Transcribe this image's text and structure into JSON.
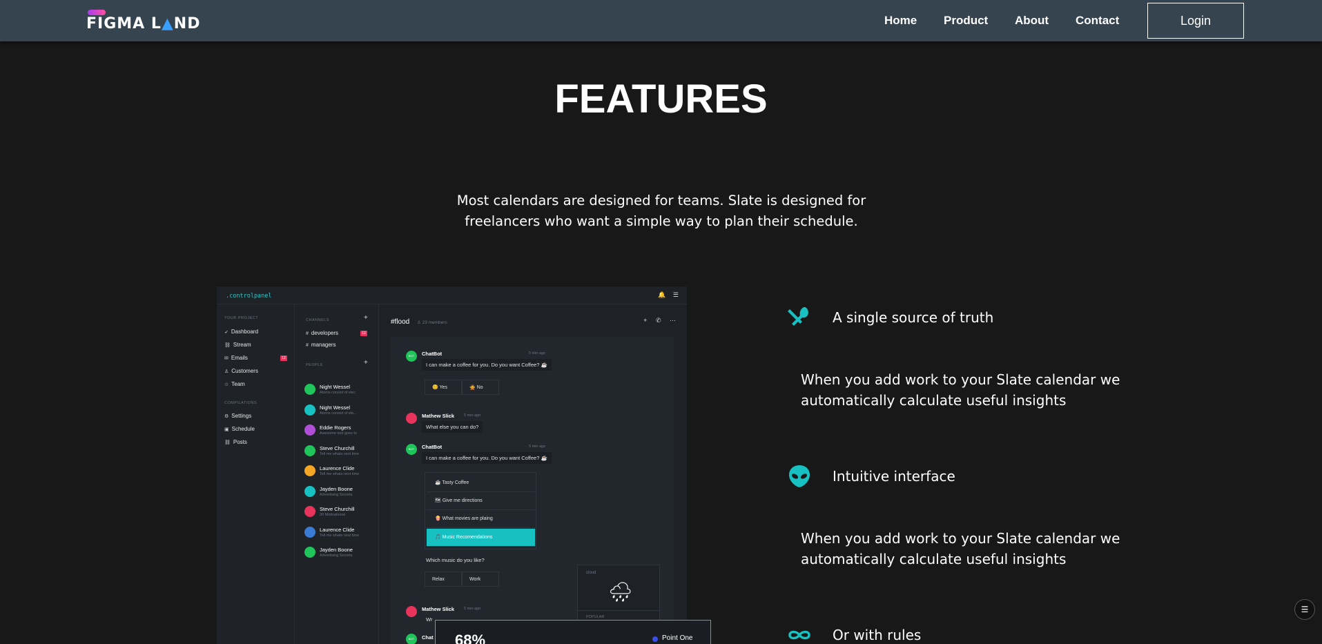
{
  "nav": {
    "logo_text_1": "FIGMA L",
    "logo_triangle": "▲",
    "logo_text_2": "ND",
    "links": [
      "Home",
      "Product",
      "About",
      "Contact"
    ],
    "login_label": "Login"
  },
  "hero": {
    "title": "FEATURES",
    "intro": "Most calendars are designed for teams. Slate is designed for freelancers who want a simple way to plan their schedule."
  },
  "mockup": {
    "brand": ".controlpanel",
    "project_section": "YOUR PROJECT",
    "project_items": [
      "Dashboard",
      "Stream",
      "Emails",
      "Customers",
      "Team"
    ],
    "emails_badge": "12",
    "compilations_section": "COMPILATIONS",
    "compilation_items": [
      "Settings",
      "Schedule",
      "Posts"
    ],
    "channels_section": "CHANNELS",
    "channels": [
      "developers",
      "managers"
    ],
    "developers_badge": "12",
    "people_section": "PEOPLE",
    "people": [
      {
        "name": "Night Wessel",
        "sub": "Atoms consist of elec",
        "color": "#1fc45a"
      },
      {
        "name": "Night Wessel",
        "sub": "Atoms consist of ele...",
        "color": "#17c1c1"
      },
      {
        "name": "Eddie Rogers",
        "sub": "Awesome tool goes to",
        "color": "#b04fd6"
      },
      {
        "name": "Steve Churchill",
        "sub": "Tell me whats next time",
        "color": "#1fc45a"
      },
      {
        "name": "Laurence Clide",
        "sub": "Tell me whats next time",
        "color": "#f5a623"
      },
      {
        "name": "Jayden Boone",
        "sub": "Advertising Secrets",
        "color": "#17c1c1"
      },
      {
        "name": "Steve Churchill",
        "sub": "20 Motivational",
        "color": "#e8335d"
      },
      {
        "name": "Laurence Clide",
        "sub": "Tell me whats next time",
        "color": "#3a7bd5"
      },
      {
        "name": "Jayden Boone",
        "sub": "Advertising Secrets",
        "color": "#1fc45a"
      }
    ],
    "channel_title": "#flood",
    "channel_members": "23 members",
    "messages": {
      "bot_name": "ChatBot",
      "bot_time": "5 min ago",
      "bot_text": "I can make a coffee for you. Do you want Coffee? ☕",
      "yes": "😊 Yes",
      "no": "🙅 No",
      "user_name": "Mathew Slick",
      "user_time": "5 min ago",
      "user_text": "What else you can do?",
      "options": [
        "☕ Tasty Coffee",
        "🗺 Give me directions",
        "🍿 What movies are plaing",
        "🎵 Music Recomendations"
      ],
      "question": "Which music do you like?",
      "relax": "Relax",
      "work": "Work",
      "user2_prefix": "Wr",
      "bot2_prefix": "Chat",
      "bot_badge": "BOT"
    },
    "weather_label": "cloud",
    "weather_popular": "POPULAR"
  },
  "overlay": {
    "percent": "68%",
    "legend": "Point One"
  },
  "features": [
    {
      "icon": "utensils-icon",
      "title": "A single source of truth",
      "desc": "When you add work to your Slate calendar we automatically calculate useful insights"
    },
    {
      "icon": "alien-icon",
      "title": "Intuitive interface",
      "desc": "When you add work to your Slate calendar we automatically calculate useful insights"
    },
    {
      "icon": "infinity-icon",
      "title": "Or with rules",
      "desc": ""
    }
  ],
  "colors": {
    "accent": "#17c1c1",
    "nav_bg": "#35444f",
    "page_bg": "#181818"
  }
}
